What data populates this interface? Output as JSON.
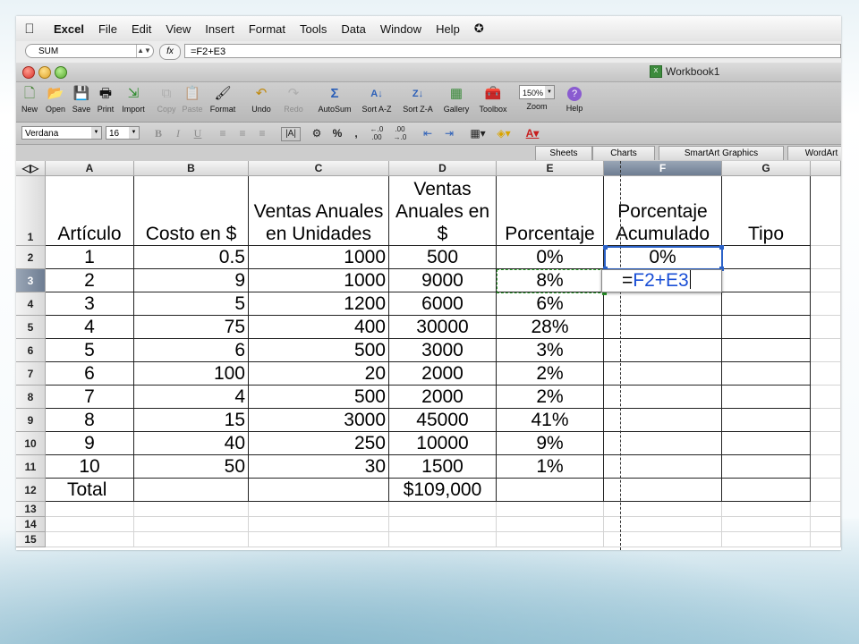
{
  "menubar": {
    "app": "Excel",
    "items": [
      "File",
      "Edit",
      "View",
      "Insert",
      "Format",
      "Tools",
      "Data",
      "Window",
      "Help"
    ]
  },
  "formula_bar": {
    "name_box": "SUM",
    "fx_label": "fx",
    "formula": "=F2+E3"
  },
  "window": {
    "title": "Workbook1"
  },
  "toolbar": {
    "items": [
      {
        "label": "New",
        "icon": "new-document-icon",
        "glyph": "🗋",
        "enabled": true
      },
      {
        "label": "Open",
        "icon": "open-folder-icon",
        "glyph": "📂",
        "enabled": true
      },
      {
        "label": "Save",
        "icon": "save-disk-icon",
        "glyph": "💾",
        "enabled": true
      },
      {
        "label": "Print",
        "icon": "printer-icon",
        "glyph": "🖶",
        "enabled": true
      },
      {
        "label": "Import",
        "icon": "import-icon",
        "glyph": "⇲",
        "enabled": true
      },
      {
        "label": "Copy",
        "icon": "copy-icon",
        "glyph": "⧉",
        "enabled": false
      },
      {
        "label": "Paste",
        "icon": "paste-clipboard-icon",
        "glyph": "📋",
        "enabled": false
      },
      {
        "label": "Format",
        "icon": "format-brush-icon",
        "glyph": "🖌",
        "enabled": true
      },
      {
        "label": "Undo",
        "icon": "undo-arrow-icon",
        "glyph": "↶",
        "enabled": true
      },
      {
        "label": "Redo",
        "icon": "redo-arrow-icon",
        "glyph": "↷",
        "enabled": false
      },
      {
        "label": "AutoSum",
        "icon": "autosum-sigma-icon",
        "glyph": "Σ",
        "enabled": true
      },
      {
        "label": "Sort A-Z",
        "icon": "sort-az-icon",
        "glyph": "A↓",
        "enabled": true
      },
      {
        "label": "Sort Z-A",
        "icon": "sort-za-icon",
        "glyph": "Z↓",
        "enabled": true
      },
      {
        "label": "Gallery",
        "icon": "gallery-icon",
        "glyph": "▦",
        "enabled": true
      },
      {
        "label": "Toolbox",
        "icon": "toolbox-icon",
        "glyph": "🧰",
        "enabled": true
      },
      {
        "label": "Zoom",
        "icon": "zoom-select",
        "glyph": "",
        "enabled": true
      },
      {
        "label": "Help",
        "icon": "help-question-icon",
        "glyph": "?",
        "enabled": true
      }
    ],
    "zoom_value": "150%"
  },
  "format_bar": {
    "font_name": "Verdana",
    "font_size": "16"
  },
  "gallery_tabs": [
    "Sheets",
    "Charts",
    "SmartArt Graphics",
    "WordArt"
  ],
  "sheet": {
    "columns": [
      "A",
      "B",
      "C",
      "D",
      "E",
      "F",
      "G"
    ],
    "rows": [
      "1",
      "2",
      "3",
      "4",
      "5",
      "6",
      "7",
      "8",
      "9",
      "10",
      "11",
      "12",
      "13",
      "14",
      "15"
    ],
    "header_row": [
      "Artículo",
      "Costo en $",
      "Ventas Anuales en Unidades",
      "Ventas Anuales en $",
      "Porcentaje",
      "Porcentaje Acumulado",
      "Tipo"
    ],
    "data": [
      [
        "1",
        "0.5",
        "1000",
        "500",
        "0%",
        "0%",
        ""
      ],
      [
        "2",
        "9",
        "1000",
        "9000",
        "8%",
        "",
        ""
      ],
      [
        "3",
        "5",
        "1200",
        "6000",
        "6%",
        "",
        ""
      ],
      [
        "4",
        "75",
        "400",
        "30000",
        "28%",
        "",
        ""
      ],
      [
        "5",
        "6",
        "500",
        "3000",
        "3%",
        "",
        ""
      ],
      [
        "6",
        "100",
        "20",
        "2000",
        "2%",
        "",
        ""
      ],
      [
        "7",
        "4",
        "500",
        "2000",
        "2%",
        "",
        ""
      ],
      [
        "8",
        "15",
        "3000",
        "45000",
        "41%",
        "",
        ""
      ],
      [
        "9",
        "40",
        "250",
        "10000",
        "9%",
        "",
        ""
      ],
      [
        "10",
        "50",
        "30",
        "1500",
        "1%",
        "",
        ""
      ],
      [
        "Total",
        "",
        "",
        "$109,000",
        "",
        "",
        ""
      ]
    ],
    "editing_cell": {
      "prefix": "=",
      "ref": "F2+E3"
    }
  }
}
